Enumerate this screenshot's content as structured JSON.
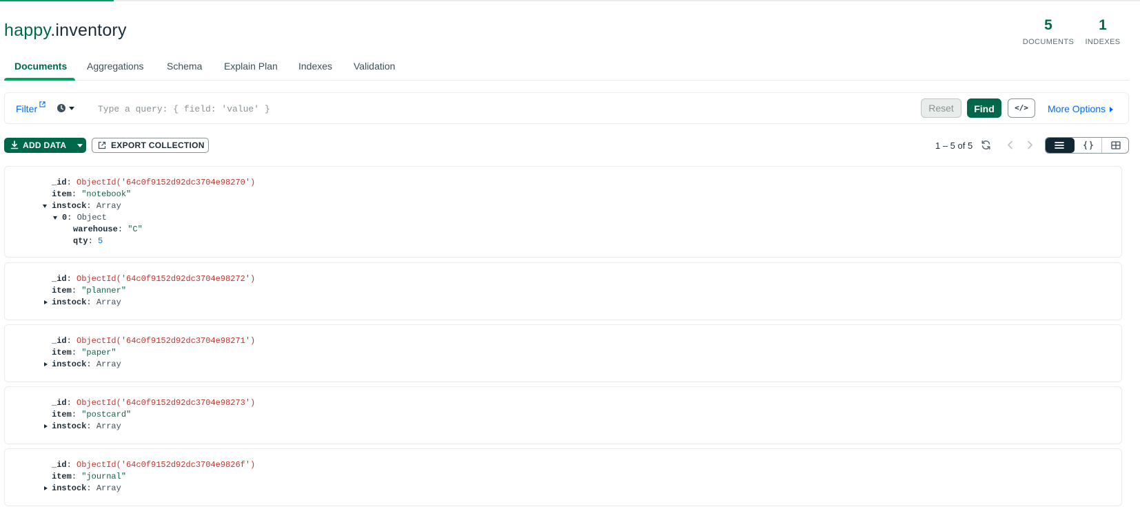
{
  "progress": {
    "fraction": 0.1
  },
  "collection": {
    "db": "happy",
    "separator": ".",
    "name": "inventory"
  },
  "stats": {
    "documents": {
      "value": "5",
      "label": "DOCUMENTS"
    },
    "indexes": {
      "value": "1",
      "label": "INDEXES"
    }
  },
  "tabs": [
    {
      "label": "Documents",
      "active": true
    },
    {
      "label": "Aggregations"
    },
    {
      "label": "Schema"
    },
    {
      "label": "Explain Plan"
    },
    {
      "label": "Indexes"
    },
    {
      "label": "Validation"
    }
  ],
  "filter": {
    "label": "Filter",
    "placeholder": "Type a query: { field: 'value' }",
    "value": "",
    "reset_label": "Reset",
    "find_label": "Find",
    "code_label": "</>",
    "more_label": "More Options"
  },
  "toolbar": {
    "add_label": "ADD DATA",
    "export_label": "EXPORT COLLECTION",
    "pagination": "1 – 5 of 5",
    "view_mode": "list"
  },
  "documents": [
    {
      "id": "ObjectId('64c0f9152d92dc3704e98270')",
      "item": "\"notebook\"",
      "instock_type": "Array",
      "expanded": true,
      "elements": [
        {
          "index": "0",
          "type": "Object",
          "warehouse": "\"C\"",
          "qty": "5"
        }
      ]
    },
    {
      "id": "ObjectId('64c0f9152d92dc3704e98272')",
      "item": "\"planner\"",
      "instock_type": "Array",
      "expanded": false
    },
    {
      "id": "ObjectId('64c0f9152d92dc3704e98271')",
      "item": "\"paper\"",
      "instock_type": "Array",
      "expanded": false
    },
    {
      "id": "ObjectId('64c0f9152d92dc3704e98273')",
      "item": "\"postcard\"",
      "instock_type": "Array",
      "expanded": false
    },
    {
      "id": "ObjectId('64c0f9152d92dc3704e9826f')",
      "item": "\"journal\"",
      "instock_type": "Array",
      "expanded": false
    }
  ],
  "field_names": {
    "id": "_id",
    "item": "item",
    "instock": "instock",
    "warehouse": "warehouse",
    "qty": "qty"
  },
  "colors": {
    "brand_green": "#00684a",
    "accent_green": "#00a35c",
    "link_blue": "#016bf8",
    "objectid_red": "#c3352e",
    "string_green": "#12634b"
  },
  "icons": {
    "external": "external-link-icon",
    "history": "clock-history-icon",
    "download": "download-icon",
    "export": "export-icon",
    "refresh": "refresh-icon",
    "prev": "chevron-left-icon",
    "next": "chevron-right-icon",
    "list": "list-view-icon",
    "json": "json-view-icon",
    "table": "table-view-icon"
  }
}
